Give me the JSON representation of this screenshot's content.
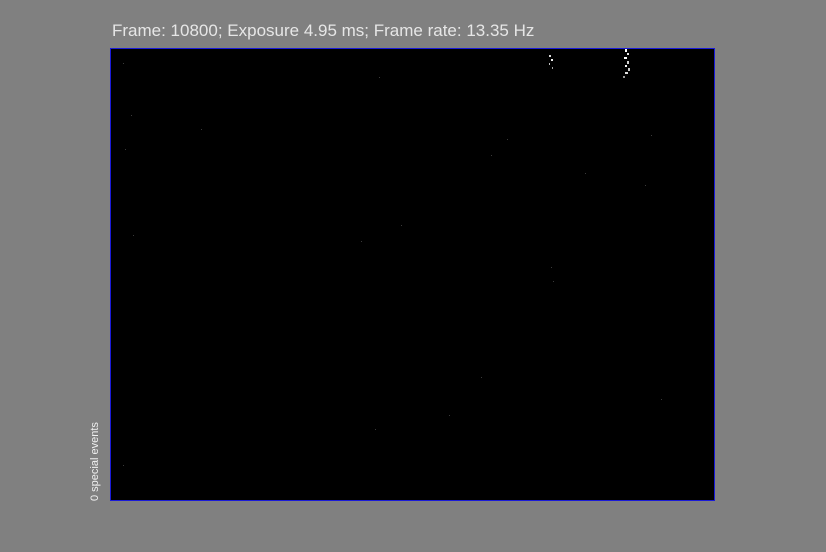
{
  "status": {
    "text": "Frame: 10800; Exposure 4.95 ms; Frame rate: 13.35 Hz"
  },
  "side_label": {
    "text": "0 special events"
  },
  "colors": {
    "background": "#808080",
    "frame_border": "#1a1ad8",
    "frame_fill": "#000000",
    "status_text": "#e6e6e6"
  }
}
